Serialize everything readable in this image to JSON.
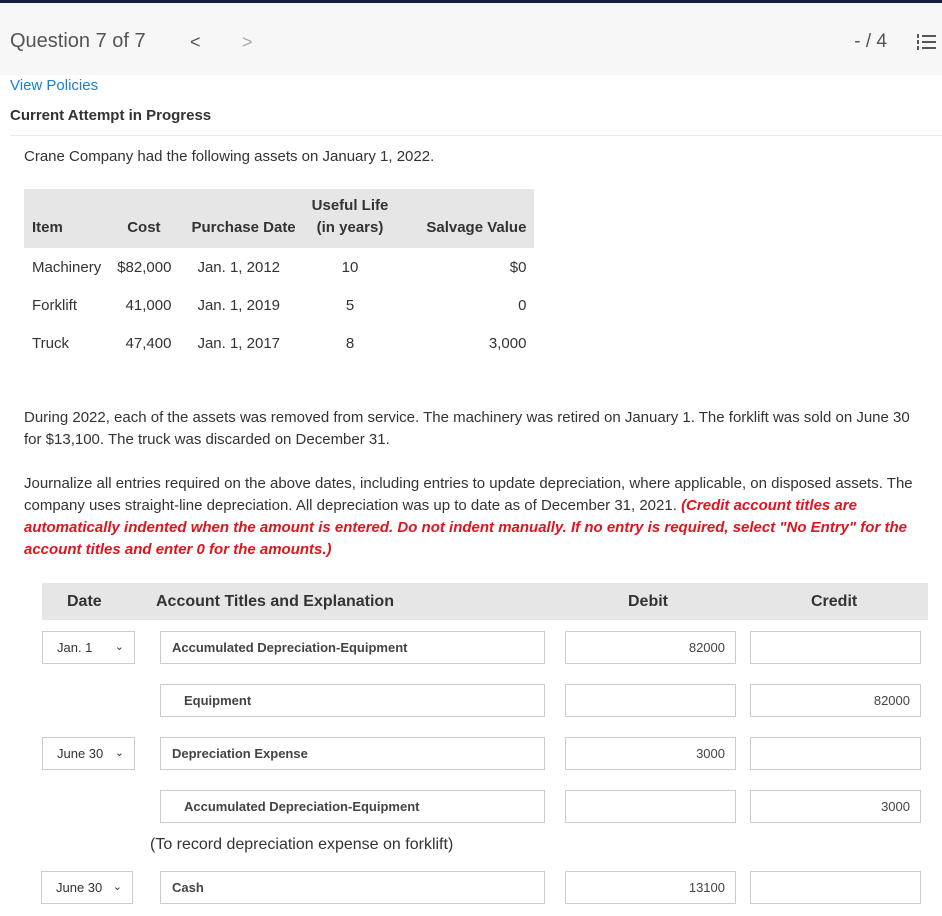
{
  "header": {
    "question": "Question 7 of 7",
    "prev": "<",
    "next": ">",
    "score": "- / 4",
    "list_icon": "numbered-list-icon"
  },
  "view_policies": "View Policies",
  "attempt": "Current Attempt in Progress",
  "intro": "Crane Company had the following assets on January 1, 2022.",
  "assets": {
    "headers": [
      "Item",
      "Cost",
      "Purchase Date",
      "Useful Life",
      "(in years)",
      "Salvage Value"
    ],
    "rows": [
      [
        "Machinery",
        "$82,000",
        "Jan. 1, 2012",
        "10",
        "$0"
      ],
      [
        "Forklift",
        "41,000",
        "Jan. 1, 2019",
        "5",
        "0"
      ],
      [
        "Truck",
        "47,400",
        "Jan. 1, 2017",
        "8",
        "3,000"
      ]
    ]
  },
  "para1": "During 2022, each of the assets was removed from service. The machinery was retired on January 1. The forklift was sold on June 30 for $13,100. The truck was discarded on December 31.",
  "para2": "Journalize all entries required on the above dates, including entries to update depreciation, where applicable, on disposed assets. The company uses straight-line depreciation. All depreciation was up to date as of December 31, 2021.",
  "para2_red": "(Credit account titles are automatically indented when the amount is entered. Do not indent manually. If no entry is required, select \"No Entry\" for the account titles and enter 0 for the amounts.)",
  "journal": {
    "headers": [
      "Date",
      "Account Titles and Explanation",
      "Debit",
      "Credit"
    ],
    "rows": [
      {
        "date": "Jan. 1",
        "account": "Accumulated Depreciation-Equipment",
        "debit": "82000",
        "credit": ""
      },
      {
        "date": "",
        "account": "Equipment",
        "debit": "",
        "credit": "82000"
      },
      {
        "date": "June 30",
        "account": "Depreciation Expense",
        "debit": "3000",
        "credit": ""
      },
      {
        "date": "",
        "account": "Accumulated Depreciation-Equipment",
        "debit": "",
        "credit": "3000"
      },
      {
        "date": "June 30",
        "account": "Cash",
        "debit": "13100",
        "credit": ""
      }
    ],
    "note": "(To record depreciation expense on forklift)"
  },
  "colors": {
    "topbar": "#14213d",
    "link": "#1a7fd4",
    "instruction_red": "#e0141e"
  }
}
